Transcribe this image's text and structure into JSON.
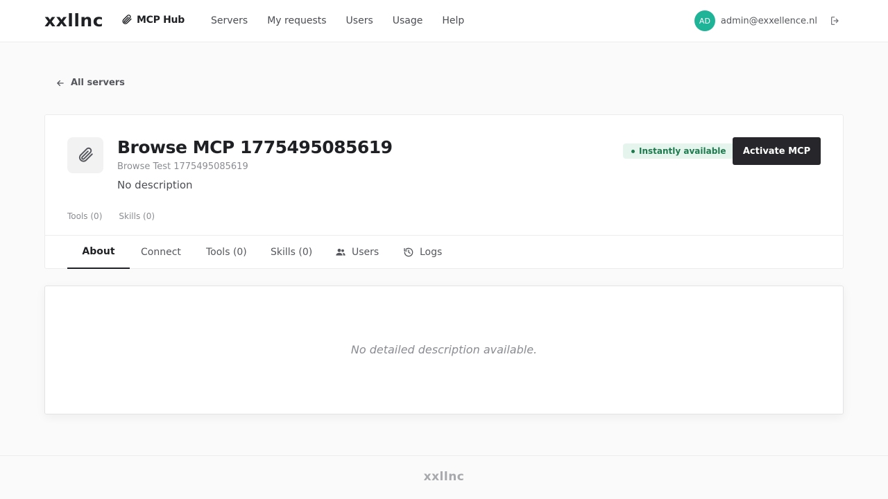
{
  "header": {
    "brand": "xxllnc",
    "hub_label": "MCP Hub",
    "hub_icon": "paperclip-icon",
    "nav": [
      {
        "label": "Servers"
      },
      {
        "label": "My requests"
      },
      {
        "label": "Users"
      },
      {
        "label": "Usage"
      },
      {
        "label": "Help"
      }
    ],
    "user": {
      "initials": "AD",
      "email": "admin@exxellence.nl",
      "avatar_color": "#1fb497",
      "logout_icon": "logout-icon"
    }
  },
  "back_link": {
    "label": "All servers",
    "icon": "arrow-left-icon"
  },
  "server": {
    "icon": "paperclip-icon",
    "title": "Browse MCP 1775495085619",
    "subtitle": "Browse Test 1775495085619",
    "description": "No description",
    "status": "Instantly available",
    "status_color": "#1c7a4d",
    "action_label": "Activate MCP",
    "counts": [
      {
        "label": "Tools (0)"
      },
      {
        "label": "Skills (0)"
      }
    ]
  },
  "tabs": [
    {
      "label": "About",
      "active": true
    },
    {
      "label": "Connect"
    },
    {
      "label": "Tools (0)"
    },
    {
      "label": "Skills (0)"
    },
    {
      "label": "Users",
      "icon": "users-icon"
    },
    {
      "label": "Logs",
      "icon": "history-icon"
    }
  ],
  "about": {
    "empty_text": "No detailed description available."
  },
  "footer": {
    "brand": "xxllnc"
  }
}
